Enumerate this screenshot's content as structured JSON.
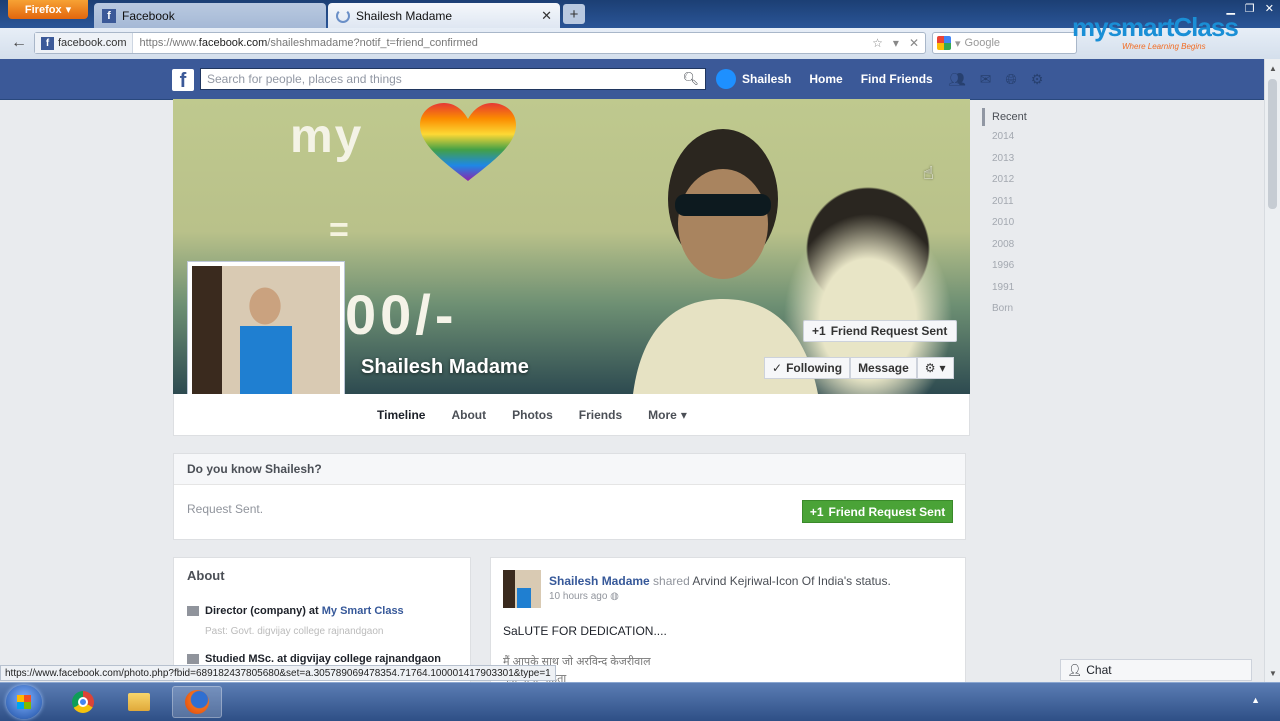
{
  "browser": {
    "firefox_label": "Firefox",
    "tabs": [
      {
        "label": "Facebook",
        "active": false
      },
      {
        "label": "Shailesh Madame",
        "active": true
      }
    ],
    "new_tab": "+",
    "site_identity": "facebook.com",
    "url_prefix": "https://www.",
    "url_domain": "facebook.com",
    "url_path": "/shaileshmadame?notif_t=friend_confirmed",
    "search_placeholder": "Google",
    "status_url": "https://www.facebook.com/photo.php?fbid=689182437805680&set=a.305789069478354.71764.100001417903301&type=1"
  },
  "watermark": {
    "brand": "mysmartClass",
    "tagline": "Where Learning Begins"
  },
  "fb_header": {
    "logo": "f",
    "search_placeholder": "Search for people, places and things",
    "user_name": "Shailesh",
    "home": "Home",
    "find_friends": "Find Friends"
  },
  "profile": {
    "name": "Shailesh Madame",
    "cover_text_my": "my",
    "cover_text_eq": "=",
    "cover_text_price": "00/-",
    "friend_request_sent": "Friend Request Sent",
    "following": "Following",
    "message": "Message",
    "tabs": [
      "Timeline",
      "About",
      "Photos",
      "Friends",
      "More"
    ]
  },
  "know_box": {
    "title": "Do you know Shailesh?",
    "status": "Request Sent.",
    "button": "Friend Request Sent"
  },
  "about": {
    "title": "About",
    "item1_prefix": "Director (company) at ",
    "item1_link": "My Smart Class",
    "item1_sub": "Past: Govt. digvijay college rajnandgaon",
    "item2": "Studied MSc. at digvijay college rajnandgaon"
  },
  "post": {
    "author": "Shailesh Madame",
    "action": " shared ",
    "object": "Arvind Kejriwal-Icon Of India's status.",
    "time": "10 hours ago",
    "text": "SaLUTE FOR DEDICATION....",
    "hindi_line1": "मैं आपके साथ जो अरविन्द केजरीवाल",
    "hindi_line2": "कह पाना चाहता"
  },
  "timeline_years": {
    "recent": "Recent",
    "years": [
      "2014",
      "2013",
      "2012",
      "2011",
      "2010",
      "2008",
      "1996",
      "1991",
      "Born"
    ]
  },
  "chat": {
    "label": "Chat"
  },
  "colors": {
    "fb_blue": "#3b5998",
    "green_button": "#4aa337",
    "link": "#365899"
  }
}
